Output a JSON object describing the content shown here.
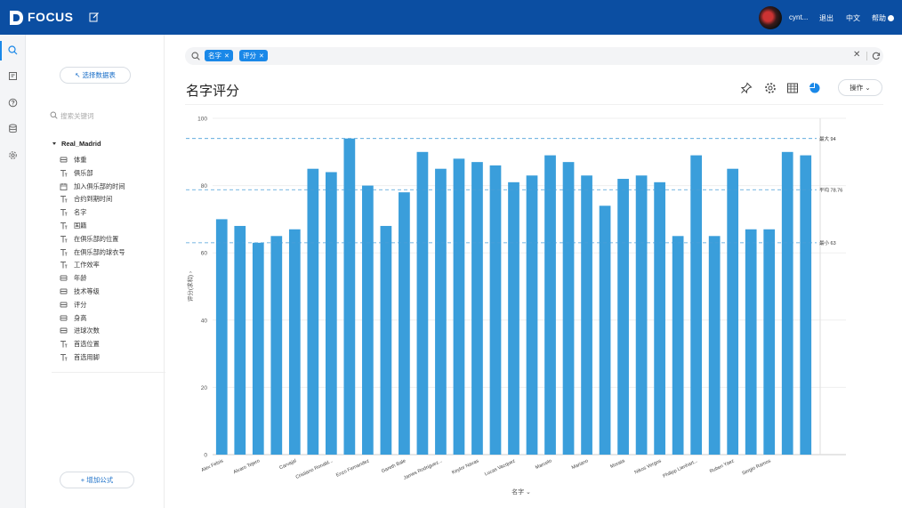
{
  "app": {
    "logo_text": "FOCUS"
  },
  "header": {
    "user_name": "cynt...",
    "logout": "退出",
    "language": "中文",
    "help": "帮助"
  },
  "sidebar_icons": [
    "search-icon",
    "bookmark-icon",
    "help-icon",
    "database-icon",
    "settings-icon"
  ],
  "data_panel": {
    "select_table": "选择数据表",
    "search_placeholder": "搜索关键词",
    "table_name": "Real_Madrid",
    "fields": [
      {
        "label": "体重",
        "type": "measure"
      },
      {
        "label": "俱乐部",
        "type": "text"
      },
      {
        "label": "加入俱乐部的时间",
        "type": "date"
      },
      {
        "label": "合约到期时间",
        "type": "text"
      },
      {
        "label": "名字",
        "type": "text"
      },
      {
        "label": "国籍",
        "type": "text"
      },
      {
        "label": "在俱乐部的位置",
        "type": "text"
      },
      {
        "label": "在俱乐部的球衣号",
        "type": "text"
      },
      {
        "label": "工作效率",
        "type": "text"
      },
      {
        "label": "年龄",
        "type": "measure"
      },
      {
        "label": "技术等级",
        "type": "measure"
      },
      {
        "label": "评分",
        "type": "measure"
      },
      {
        "label": "身高",
        "type": "measure"
      },
      {
        "label": "进球次数",
        "type": "measure"
      },
      {
        "label": "首选位置",
        "type": "text"
      },
      {
        "label": "首选用脚",
        "type": "text"
      }
    ],
    "add_formula": "增加公式"
  },
  "search": {
    "tags": [
      {
        "label": "名字"
      },
      {
        "label": "评分"
      }
    ]
  },
  "toolbar": {
    "operations": "操作"
  },
  "colors": {
    "accent": "#1a88e8",
    "header_bg": "#0b4ea2",
    "bar": "#3a9edb",
    "refline": "#4a9fd8"
  },
  "chart_data": {
    "type": "bar",
    "title": "名字评分",
    "xlabel": "名字",
    "ylabel": "评分(求和)",
    "ylim": [
      0,
      100
    ],
    "yticks": [
      0,
      20,
      40,
      60,
      80,
      100
    ],
    "categories": [
      "Alex Felsis",
      "Alvaro Tejero",
      "Carvajal",
      "Cristiano Ronald...",
      "Enzo Fernandez",
      "Gareth Bale",
      "James Rodriguez...",
      "Keylor Navas",
      "Lucas Vazquez",
      "Marcelo",
      "Mariano",
      "Morata",
      "Nikos Vergos",
      "Philipp Lienhart...",
      "Ruben Yaez",
      "Sergio Ramos"
    ],
    "series": [
      {
        "values": [
          70,
          68,
          63,
          65,
          67,
          85,
          84,
          94,
          80,
          68,
          78,
          90,
          85,
          88,
          87,
          86,
          81,
          83,
          89,
          87,
          83,
          74,
          82,
          83,
          81,
          65,
          89,
          65,
          85,
          67,
          67,
          90,
          89
        ]
      }
    ],
    "reference_lines": [
      {
        "label": "最大 94",
        "value": 94
      },
      {
        "label": "平均 78.76",
        "value": 78.76
      },
      {
        "label": "最小 63",
        "value": 63
      }
    ],
    "grid": true,
    "legend": "none"
  }
}
